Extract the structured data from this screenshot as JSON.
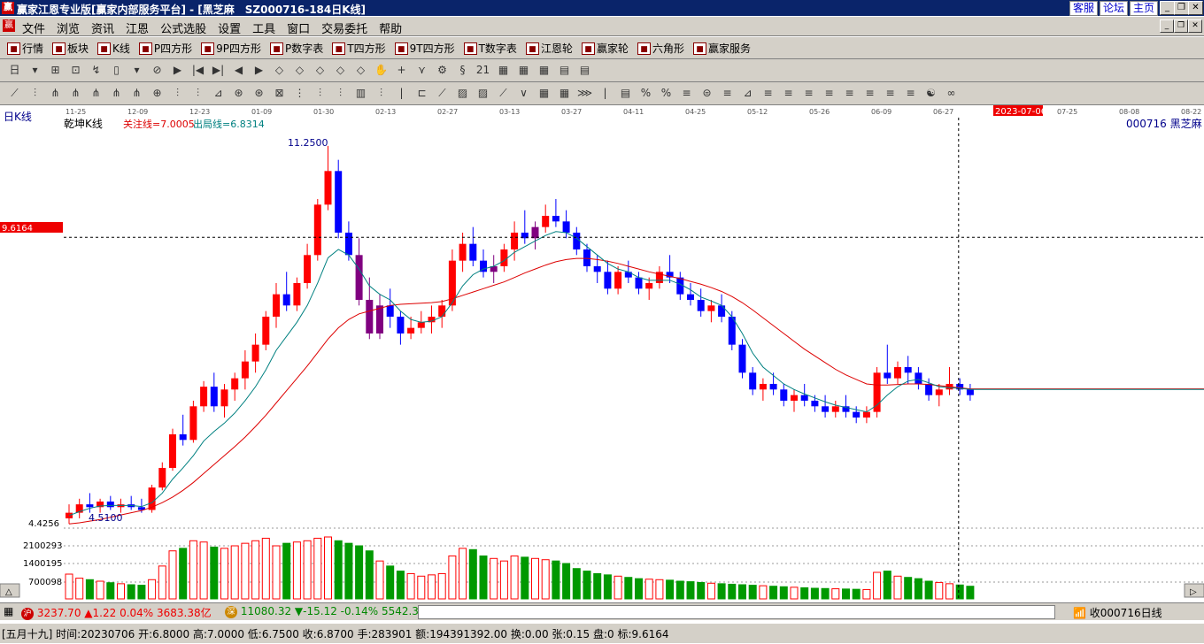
{
  "window": {
    "title": "赢家江恩专业版[赢家内部服务平台] - [黑芝麻　SZ000716-184日K线]",
    "links": [
      "客服",
      "论坛",
      "主页"
    ]
  },
  "menu": [
    "文件",
    "浏览",
    "资讯",
    "江恩",
    "公式选股",
    "设置",
    "工具",
    "窗口",
    "交易委托",
    "帮助"
  ],
  "toolbar1": [
    {
      "icon": "table-icon",
      "label": "行情"
    },
    {
      "icon": "blocks-icon",
      "label": "板块"
    },
    {
      "icon": "candle-icon",
      "label": "K线"
    },
    {
      "icon": "ps-icon",
      "label": "P四方形"
    },
    {
      "icon": "p9-icon",
      "label": "9P四方形"
    },
    {
      "icon": "pn-icon",
      "label": "P数字表"
    },
    {
      "icon": "ts-icon",
      "label": "T四方形"
    },
    {
      "icon": "t9-icon",
      "label": "9T四方形"
    },
    {
      "icon": "tn-icon",
      "label": "T数字表"
    },
    {
      "icon": "wheel-icon",
      "label": "江恩轮"
    },
    {
      "icon": "wheel-icon",
      "label": "赢家轮"
    },
    {
      "icon": "hexagon-icon",
      "label": "六角形"
    },
    {
      "icon": "dollar-icon",
      "label": "赢家服务"
    }
  ],
  "toolbar2": [
    "日",
    "▾",
    "⊞",
    "⊡",
    "↯",
    "▯",
    "▾",
    "⊘",
    "▶",
    "|◀",
    "▶|",
    "◀",
    "▶",
    "◇",
    "◇",
    "◇",
    "◇",
    "◇",
    "✋",
    "+",
    "⋎",
    "⚙",
    "§",
    "21",
    "▦",
    "▦",
    "▦",
    "▤",
    "▤"
  ],
  "toolbar3": [
    "⟋",
    "⫶",
    "⋔",
    "⋔",
    "⋔",
    "⋔",
    "⋔",
    "⊕",
    "⫶",
    "⫶",
    "⊿",
    "⊛",
    "⊛",
    "⊠",
    "⋮",
    "⫶",
    "⫶",
    "▥",
    "⫶",
    "|",
    "⊏",
    "⟋",
    "▨",
    "▨",
    "⟋",
    "∨",
    "▦",
    "▦",
    "⋙",
    "|",
    "▤",
    "%",
    "%",
    "≡",
    "⊜",
    "≡",
    "⊿",
    "≡",
    "≡",
    "≡",
    "≡",
    "≡",
    "≡",
    "≡",
    "≡",
    "☯",
    "∞"
  ],
  "chart_labels": {
    "period": "日K线",
    "indicator": "乾坤K线",
    "attention_line": "关注线=7.0005",
    "exit_line": "出局线=6.8314",
    "stock": "000716  黑芝麻",
    "cursor_price": "9.6164",
    "cursor_date": "2023-07-06",
    "high_label": "11.2500",
    "low_label": "4.5100",
    "axis_min": "4.4256",
    "volume_ticks": [
      "2100293",
      "1400195",
      "700098"
    ]
  },
  "chart_data": {
    "type": "candlestick",
    "x_ticks": [
      "11-25",
      "12-09",
      "12-23",
      "01-09",
      "01-30",
      "02-13",
      "02-27",
      "03-13",
      "03-27",
      "04-11",
      "04-25",
      "05-12",
      "05-26",
      "06-09",
      "06-27",
      "2023-07-06",
      "07-25",
      "08-08",
      "08-22"
    ],
    "ylim": [
      4.4256,
      11.5
    ],
    "annotations": [
      {
        "label": "11.2500",
        "value": 11.25
      },
      {
        "label": "4.5100",
        "value": 4.51
      }
    ],
    "ohlc": [
      [
        4.6,
        4.85,
        4.5,
        4.7
      ],
      [
        4.7,
        4.95,
        4.6,
        4.85
      ],
      [
        4.85,
        5.05,
        4.7,
        4.8
      ],
      [
        4.8,
        4.95,
        4.7,
        4.9
      ],
      [
        4.9,
        5.0,
        4.75,
        4.8
      ],
      [
        4.8,
        4.95,
        4.7,
        4.85
      ],
      [
        4.85,
        5.0,
        4.75,
        4.8
      ],
      [
        4.8,
        4.95,
        4.7,
        4.75
      ],
      [
        4.75,
        5.2,
        4.7,
        5.15
      ],
      [
        5.15,
        5.6,
        5.1,
        5.5
      ],
      [
        5.5,
        6.2,
        5.45,
        6.1
      ],
      [
        6.1,
        6.45,
        5.9,
        6.0
      ],
      [
        6.0,
        6.7,
        5.95,
        6.6
      ],
      [
        6.6,
        7.05,
        6.5,
        6.95
      ],
      [
        6.95,
        7.2,
        6.5,
        6.6
      ],
      [
        6.6,
        7.0,
        6.4,
        6.9
      ],
      [
        6.9,
        7.2,
        6.7,
        7.1
      ],
      [
        7.1,
        7.6,
        6.9,
        7.4
      ],
      [
        7.4,
        7.9,
        7.2,
        7.7
      ],
      [
        7.7,
        8.3,
        7.6,
        8.2
      ],
      [
        8.2,
        8.8,
        8.0,
        8.6
      ],
      [
        8.6,
        9.0,
        8.3,
        8.4
      ],
      [
        8.4,
        8.9,
        8.3,
        8.8
      ],
      [
        8.8,
        9.5,
        8.7,
        9.3
      ],
      [
        9.3,
        10.3,
        9.2,
        10.2
      ],
      [
        10.2,
        11.25,
        10.1,
        10.8
      ],
      [
        10.8,
        11.0,
        9.6,
        9.7
      ],
      [
        9.7,
        9.9,
        9.2,
        9.3
      ],
      [
        9.3,
        9.6,
        8.4,
        8.5
      ],
      [
        8.5,
        8.9,
        7.8,
        7.9
      ],
      [
        7.9,
        8.6,
        7.8,
        8.4
      ],
      [
        8.4,
        8.7,
        8.0,
        8.2
      ],
      [
        8.2,
        8.3,
        7.7,
        7.9
      ],
      [
        7.9,
        8.2,
        7.8,
        8.0
      ],
      [
        8.0,
        8.3,
        7.9,
        8.1
      ],
      [
        8.1,
        8.4,
        7.9,
        8.2
      ],
      [
        8.2,
        8.5,
        8.0,
        8.4
      ],
      [
        8.4,
        9.4,
        8.3,
        9.2
      ],
      [
        9.2,
        9.7,
        9.0,
        9.5
      ],
      [
        9.5,
        9.8,
        9.1,
        9.2
      ],
      [
        9.2,
        9.4,
        8.9,
        9.0
      ],
      [
        9.0,
        9.3,
        8.8,
        9.1
      ],
      [
        9.1,
        9.5,
        9.0,
        9.4
      ],
      [
        9.4,
        9.9,
        9.2,
        9.7
      ],
      [
        9.7,
        10.1,
        9.5,
        9.6
      ],
      [
        9.6,
        9.9,
        9.4,
        9.8
      ],
      [
        9.8,
        10.2,
        9.7,
        10.0
      ],
      [
        10.0,
        10.3,
        9.8,
        9.9
      ],
      [
        9.9,
        10.1,
        9.6,
        9.7
      ],
      [
        9.7,
        9.8,
        9.3,
        9.4
      ],
      [
        9.4,
        9.5,
        9.0,
        9.1
      ],
      [
        9.1,
        9.3,
        8.8,
        9.0
      ],
      [
        9.0,
        9.2,
        8.6,
        8.7
      ],
      [
        8.7,
        9.1,
        8.6,
        9.0
      ],
      [
        9.0,
        9.2,
        8.8,
        8.9
      ],
      [
        8.9,
        9.0,
        8.6,
        8.7
      ],
      [
        8.7,
        8.9,
        8.5,
        8.8
      ],
      [
        8.8,
        9.1,
        8.7,
        9.0
      ],
      [
        9.0,
        9.3,
        8.8,
        8.9
      ],
      [
        8.9,
        9.0,
        8.5,
        8.6
      ],
      [
        8.6,
        8.8,
        8.4,
        8.5
      ],
      [
        8.5,
        8.7,
        8.2,
        8.3
      ],
      [
        8.3,
        8.5,
        8.1,
        8.4
      ],
      [
        8.4,
        8.6,
        8.1,
        8.2
      ],
      [
        8.2,
        8.3,
        7.6,
        7.7
      ],
      [
        7.7,
        7.8,
        7.1,
        7.2
      ],
      [
        7.2,
        7.3,
        6.8,
        6.9
      ],
      [
        6.9,
        7.1,
        6.7,
        7.0
      ],
      [
        7.0,
        7.2,
        6.8,
        6.9
      ],
      [
        6.9,
        7.0,
        6.6,
        6.7
      ],
      [
        6.7,
        6.9,
        6.5,
        6.8
      ],
      [
        6.8,
        7.0,
        6.6,
        6.7
      ],
      [
        6.7,
        6.8,
        6.5,
        6.6
      ],
      [
        6.6,
        6.8,
        6.4,
        6.5
      ],
      [
        6.5,
        6.7,
        6.4,
        6.6
      ],
      [
        6.6,
        6.8,
        6.4,
        6.5
      ],
      [
        6.5,
        6.6,
        6.3,
        6.4
      ],
      [
        6.4,
        6.6,
        6.3,
        6.5
      ],
      [
        6.5,
        7.3,
        6.4,
        7.2
      ],
      [
        7.2,
        7.7,
        7.0,
        7.1
      ],
      [
        7.1,
        7.4,
        7.0,
        7.3
      ],
      [
        7.3,
        7.5,
        7.0,
        7.2
      ],
      [
        7.2,
        7.3,
        6.9,
        7.0
      ],
      [
        7.0,
        7.1,
        6.7,
        6.8
      ],
      [
        6.8,
        7.0,
        6.6,
        6.9
      ],
      [
        6.9,
        7.3,
        6.8,
        7.0
      ],
      [
        7.0,
        7.1,
        6.8,
        6.9
      ],
      [
        6.9,
        7.0,
        6.7,
        6.8
      ]
    ],
    "ma_fast": [
      4.65,
      4.72,
      4.78,
      4.82,
      4.83,
      4.83,
      4.83,
      4.81,
      4.88,
      5.05,
      5.3,
      5.5,
      5.72,
      5.98,
      6.15,
      6.3,
      6.48,
      6.7,
      6.95,
      7.25,
      7.6,
      7.85,
      8.1,
      8.4,
      8.8,
      9.25,
      9.4,
      9.3,
      9.05,
      8.75,
      8.6,
      8.5,
      8.3,
      8.15,
      8.1,
      8.12,
      8.2,
      8.45,
      8.75,
      8.95,
      9.05,
      9.1,
      9.2,
      9.35,
      9.45,
      9.55,
      9.65,
      9.72,
      9.7,
      9.6,
      9.45,
      9.3,
      9.15,
      9.05,
      9.0,
      8.9,
      8.85,
      8.85,
      8.85,
      8.78,
      8.68,
      8.55,
      8.48,
      8.4,
      8.2,
      7.9,
      7.55,
      7.3,
      7.15,
      7.0,
      6.9,
      6.82,
      6.75,
      6.68,
      6.62,
      6.58,
      6.54,
      6.5,
      6.62,
      6.8,
      6.95,
      7.05,
      7.08,
      7.02,
      6.95,
      6.93,
      6.92,
      6.9
    ],
    "ma_slow": [
      4.5,
      4.52,
      4.55,
      4.58,
      4.62,
      4.66,
      4.7,
      4.74,
      4.8,
      4.88,
      4.98,
      5.1,
      5.24,
      5.4,
      5.56,
      5.72,
      5.88,
      6.05,
      6.24,
      6.44,
      6.66,
      6.88,
      7.1,
      7.32,
      7.56,
      7.8,
      8.0,
      8.15,
      8.25,
      8.3,
      8.35,
      8.4,
      8.42,
      8.43,
      8.44,
      8.45,
      8.47,
      8.52,
      8.58,
      8.64,
      8.7,
      8.76,
      8.82,
      8.9,
      8.98,
      9.05,
      9.12,
      9.18,
      9.22,
      9.24,
      9.24,
      9.22,
      9.19,
      9.15,
      9.1,
      9.05,
      9.0,
      8.96,
      8.92,
      8.88,
      8.83,
      8.78,
      8.72,
      8.65,
      8.56,
      8.45,
      8.32,
      8.18,
      8.04,
      7.9,
      7.76,
      7.62,
      7.5,
      7.38,
      7.26,
      7.16,
      7.08,
      7.0,
      6.98,
      6.98,
      6.99,
      7.0,
      7.0,
      6.99,
      6.97,
      6.95,
      6.93,
      6.91
    ],
    "volume": [
      980000,
      820000,
      760000,
      700000,
      640000,
      600000,
      560000,
      540000,
      760000,
      1300000,
      1900000,
      2000000,
      2300000,
      2250000,
      2050000,
      2000000,
      2100000,
      2200000,
      2300000,
      2400000,
      2100000,
      2200000,
      2250000,
      2300000,
      2400000,
      2450000,
      2300000,
      2200000,
      2100000,
      1900000,
      1500000,
      1300000,
      1100000,
      1000000,
      900000,
      950000,
      1000000,
      1700000,
      2000000,
      1950000,
      1700000,
      1600000,
      1500000,
      1700000,
      1650000,
      1600000,
      1550000,
      1500000,
      1400000,
      1200000,
      1100000,
      1000000,
      950000,
      900000,
      850000,
      800000,
      780000,
      760000,
      740000,
      700000,
      680000,
      650000,
      620000,
      600000,
      580000,
      560000,
      540000,
      520000,
      500000,
      480000,
      460000,
      440000,
      420000,
      410000,
      400000,
      390000,
      380000,
      370000,
      1050000,
      1100000,
      900000,
      850000,
      800000,
      700000,
      650000,
      600000,
      550000,
      500000
    ],
    "volume_ylim": [
      0,
      2800390
    ],
    "volume_ticks": [
      2100293,
      1400195,
      700098
    ],
    "cursor_index": 84
  },
  "status": {
    "sh_value": "3237.70",
    "sh_change": "▲1.22",
    "sh_pct": "0.04%",
    "sh_amount": "3683.38亿",
    "sz_value": "11080.32",
    "sz_change": "▼-15.12",
    "sz_pct": "-0.14%",
    "sz_amount": "5542.3",
    "sh_icon_label": "沪",
    "sz_icon_label": "深",
    "recv": "收000716日线"
  },
  "info": "[五月十九] 时间:20230706 开:6.8000 高:7.0000 低:6.7500 收:6.8700 手:283901 额:194391392.00 换:0.00 张:0.15 盘:0 标:9.6164"
}
